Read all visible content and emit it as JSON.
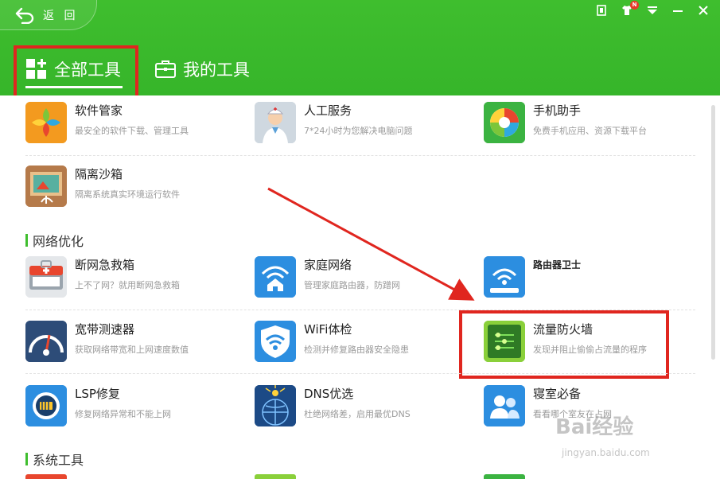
{
  "header": {
    "back_label": "返 回",
    "notification_badge": "N",
    "tabs": [
      {
        "label": "全部工具"
      },
      {
        "label": "我的工具"
      }
    ]
  },
  "sections": [
    {
      "title": "网络优化"
    },
    {
      "title": "系统工具"
    }
  ],
  "tools": [
    {
      "name": "软件管家",
      "desc": "最安全的软件下载、管理工具",
      "icon": "software-manager-icon"
    },
    {
      "name": "人工服务",
      "desc": "7*24小时为您解决电脑问题",
      "icon": "human-service-icon"
    },
    {
      "name": "手机助手",
      "desc": "免费手机应用、资源下载平台",
      "icon": "phone-assistant-icon"
    },
    {
      "name": "隔离沙箱",
      "desc": "隔离系统真实环境运行软件",
      "icon": "sandbox-icon"
    },
    {
      "name": "断网急救箱",
      "desc": "上不了网？就用断网急救箱",
      "icon": "first-aid-kit-icon"
    },
    {
      "name": "家庭网络",
      "desc": "管理家庭路由器，防蹭网",
      "icon": "home-network-icon"
    },
    {
      "name": "路由器卫士",
      "desc": "",
      "icon": "router-guard-icon"
    },
    {
      "name": "宽带测速器",
      "desc": "获取网络带宽和上网速度数值",
      "icon": "speed-test-icon"
    },
    {
      "name": "WiFi体检",
      "desc": "检测并修复路由器安全隐患",
      "icon": "wifi-check-icon"
    },
    {
      "name": "流量防火墙",
      "desc": "发现并阻止偷偷占流量的程序",
      "icon": "traffic-firewall-icon"
    },
    {
      "name": "LSP修复",
      "desc": "修复网络异常和不能上网",
      "icon": "lsp-repair-icon"
    },
    {
      "name": "DNS优选",
      "desc": "杜绝网络差，启用最优DNS",
      "icon": "dns-select-icon"
    },
    {
      "name": "寝室必备",
      "desc": "看看哪个室友在占网",
      "icon": "dorm-essential-icon"
    }
  ],
  "watermark": {
    "brand": "Bai经验",
    "url": "jingyan.baidu.com"
  },
  "colors": {
    "brand_green": "#3fbe2e",
    "highlight_red": "#e0261f"
  }
}
